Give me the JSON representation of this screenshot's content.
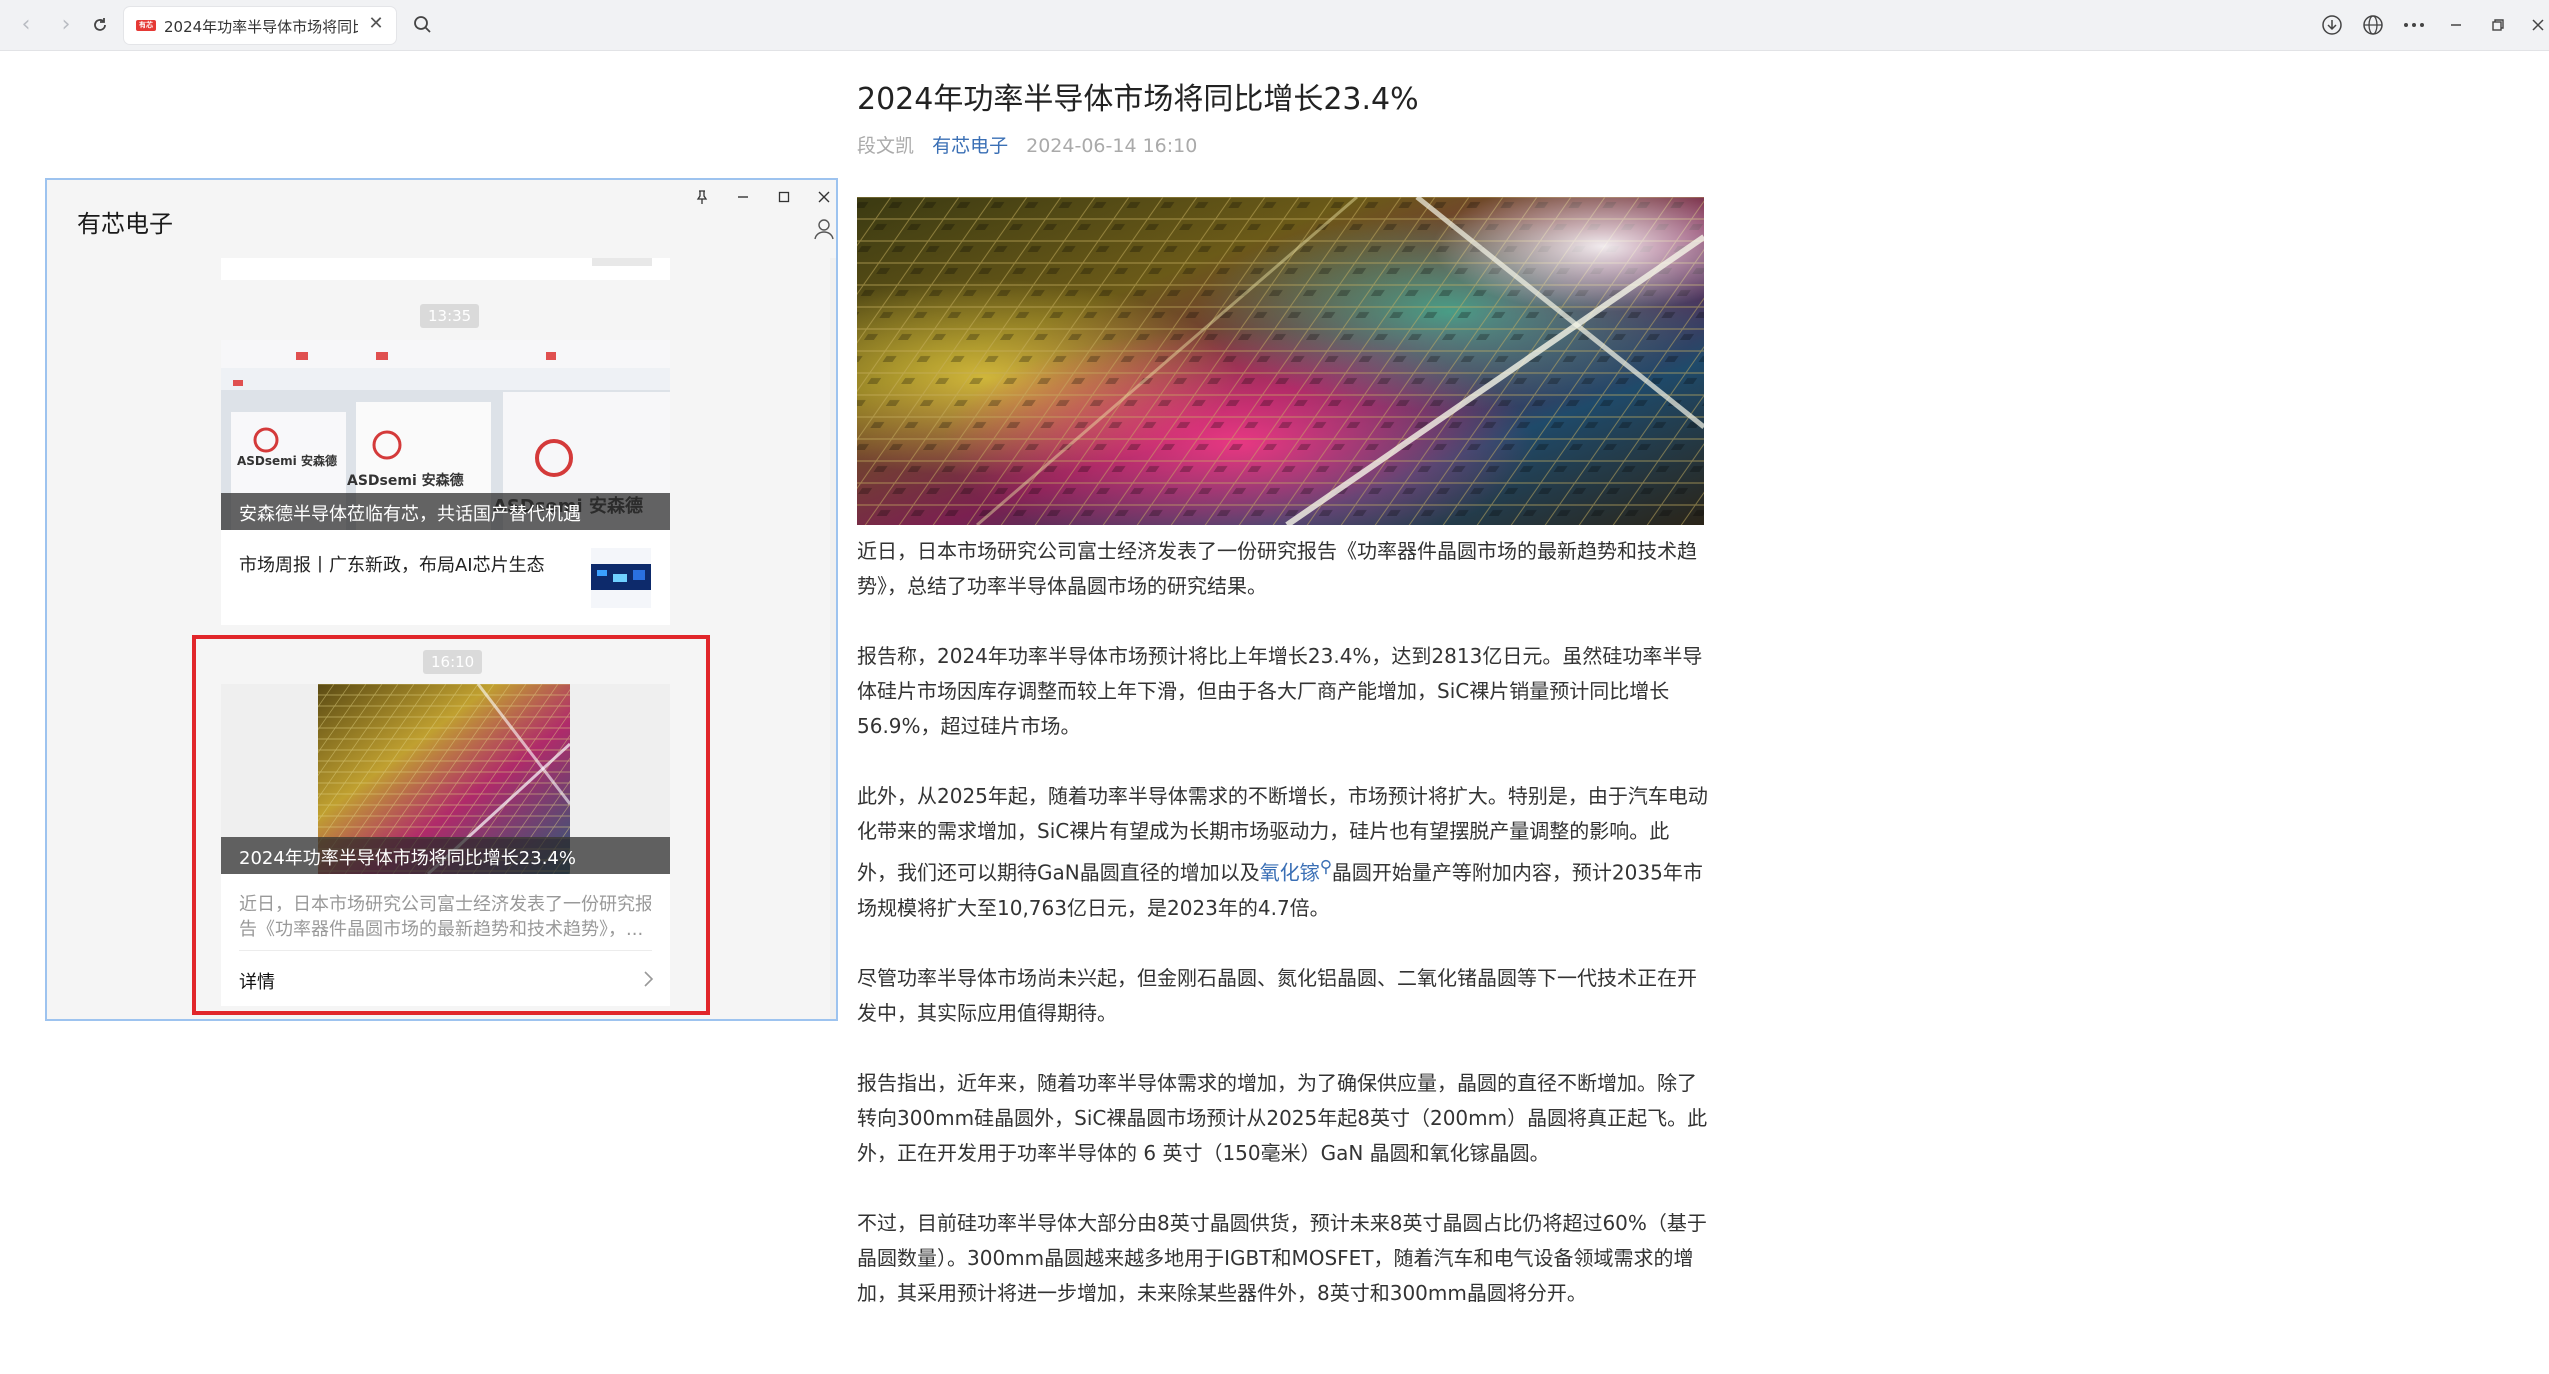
{
  "browser": {
    "tab": {
      "favicon_text": "有芯",
      "title": "2024年功率半导体市场将同比增长23.4%",
      "close_glyph": "✕"
    },
    "icons": [
      "back-icon",
      "forward-icon",
      "reload-icon",
      "search-icon",
      "download-icon",
      "globe-icon",
      "more-icon",
      "minimize-icon",
      "restore-icon",
      "close-icon"
    ]
  },
  "article": {
    "title": "2024年功率半导体市场将同比增长23.4%",
    "author": "段文凯",
    "source": "有芯电子",
    "date": "2024-06-14 16:10",
    "paragraphs": [
      "近日，日本市场研究公司富士经济发表了一份研究报告《功率器件晶圆市场的最新趋势和技术趋势》，总结了功率半导体晶圆市场的研究结果。",
      "报告称，2024年功率半导体市场预计将比上年增长23.4%，达到2813亿日元。虽然硅功率半导体硅片市场因库存调整而较上年下滑，但由于各大厂商产能增加，SiC裸片销量预计同比增长56.9%，超过硅片市场。",
      {
        "before": "此外，从2025年起，随着功率半导体需求的不断增长，市场预计将扩大。特别是，由于汽车电动化带来的需求增加，SiC裸片有望成为长期市场驱动力，硅片也有望摆脱产量调整的影响。此外，我们还可以期待GaN晶圆直径的增加以及",
        "link": "氧化镓",
        "after": "晶圆开始量产等附加内容，预计2035年市场规模将扩大至10,763亿日元，是2023年的4.7倍。"
      },
      "尽管功率半导体市场尚未兴起，但金刚石晶圆、氮化铝晶圆、二氧化锗晶圆等下一代技术正在开发中，其实际应用值得期待。",
      "报告指出，近年来，随着功率半导体需求的增加，为了确保供应量，晶圆的直径不断增加。除了转向300mm硅晶圆外，SiC裸晶圆市场预计从2025年起8英寸（200mm）晶圆将真正起飞。此外，正在开发用于功率半导体的 6 英寸（150毫米）GaN 晶圆和氧化镓晶圆。",
      "不过，目前硅功率半导体大部分由8英寸晶圆供货，预计未来8英寸晶圆占比仍将超过60%（基于晶圆数量）。300mm晶圆越来越多地用于IGBT和MOSFET，随着汽车和电气设备领域需求的增加，其采用预计将进一步增加，未来除某些器件外，8英寸和300mm晶圆将分开。"
    ]
  },
  "popup": {
    "title": "有芯电子",
    "messages": [
      {
        "time": "13:35",
        "cover_caption": "安森德半导体莅临有芯，共话国产替代机遇",
        "cover_logo_text": "ASDsemi 安森德",
        "row_title": "市场周报丨广东新政，布局AI芯片生态"
      },
      {
        "time": "16:10",
        "cover_caption": "2024年功率半导体市场将同比增长23.4%",
        "digest_lines": [
          "近日，日本市场研究公司富士经济发表了一份研究报",
          "告《功率器件晶圆市场的最新趋势和技术趋势》，..."
        ],
        "details_label": "详情"
      }
    ]
  },
  "colors": {
    "highlight": "#e1262a",
    "link": "#3a6fb5",
    "window_border": "#9dc3ef"
  }
}
